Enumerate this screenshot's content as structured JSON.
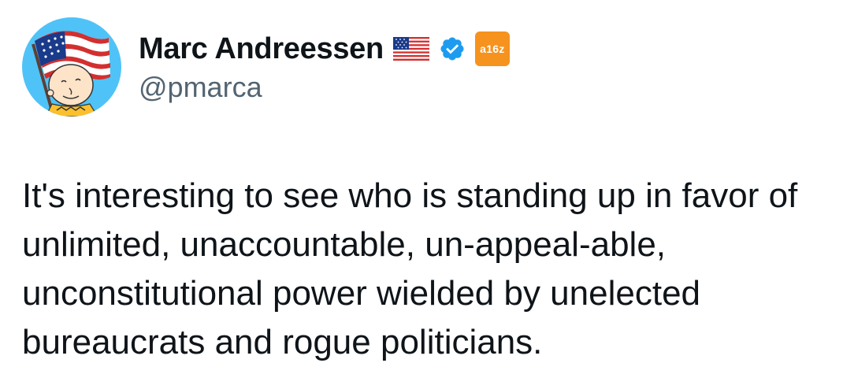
{
  "author": {
    "display_name": "Marc Andreessen",
    "handle": "@pmarca",
    "name_emoji": "flag-usa-icon",
    "verified_icon": "verified-badge-icon",
    "verified_color": "#1d9bf0",
    "affiliate_label": "a16z",
    "affiliate_color": "#f6921e",
    "avatar_icon": "avatar-flag-character-icon"
  },
  "tweet": {
    "text": "It's interesting to see who is standing up in favor of unlimited, unaccountable, un-appeal-able, unconstitutional power wielded by unelected bureaucrats and rogue politicians."
  },
  "colors": {
    "text_primary": "#0f1419",
    "text_secondary": "#536471",
    "avatar_background": "#4fc3f7"
  }
}
